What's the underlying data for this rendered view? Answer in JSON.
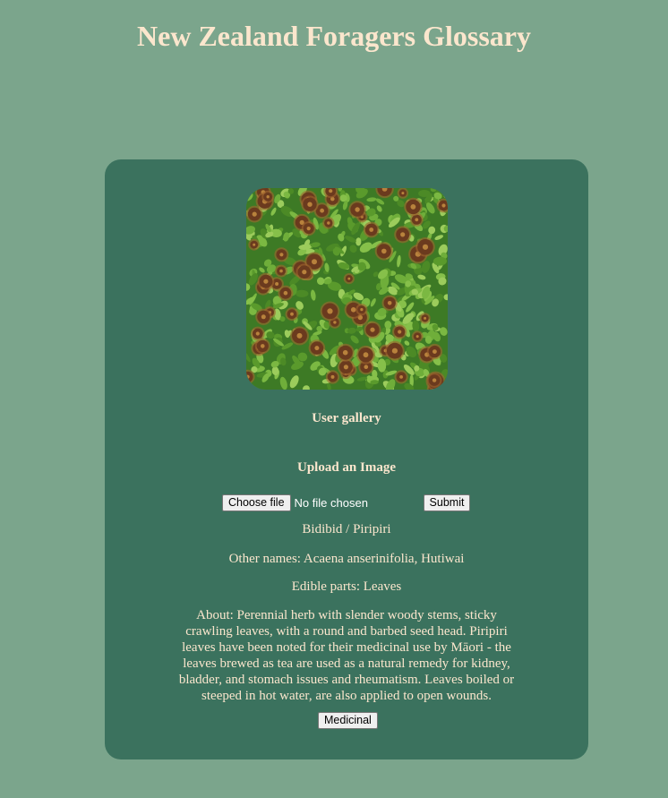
{
  "header": {
    "title": "New Zealand Foragers Glossary"
  },
  "card": {
    "image_alt": "Bidibid / Piripiri plant",
    "gallery_link": "User gallery",
    "upload": {
      "heading": "Upload an Image",
      "choose_file_label": "Choose file",
      "file_status": "No file chosen",
      "submit_label": "Submit"
    },
    "plant": {
      "name": "Bidibid / Piripiri",
      "other_names": "Other names: Acaena anserinifolia, Hutiwai",
      "edible_parts": "Edible parts: Leaves",
      "about": "About: Perennial herb with slender woody stems, sticky crawling leaves, with a round and barbed seed head. Piripiri leaves have been noted for their medicinal use by Māori - the leaves brewed as tea are used as a natural remedy for kidney, bladder, and stomach issues and rheumatism. Leaves boiled or steeped in hot water, are also applied to open wounds.",
      "tag_label": "Medicinal"
    }
  },
  "colors": {
    "page_background": "#7ba58c",
    "card_background": "#3b725e",
    "text_cream": "#fbe6cd"
  }
}
